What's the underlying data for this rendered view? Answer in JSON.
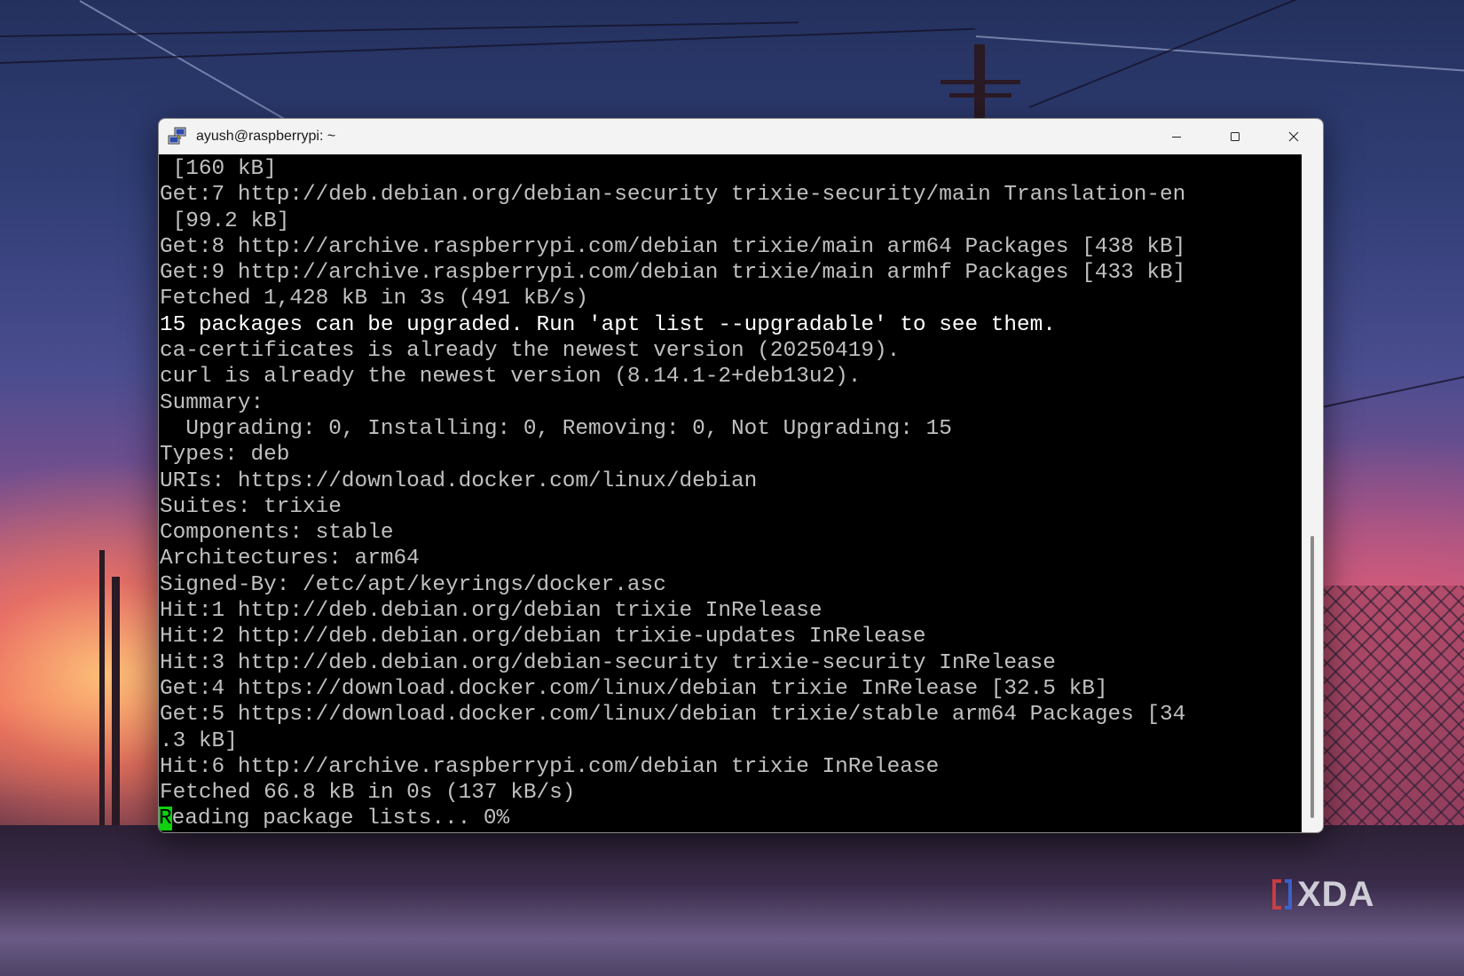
{
  "window": {
    "title": "ayush@raspberrypi: ~",
    "app_icon": "putty-icon",
    "controls": {
      "minimize_icon": "minimize-icon",
      "maximize_icon": "maximize-icon",
      "close_icon": "close-icon"
    }
  },
  "terminal": {
    "lines": [
      {
        "text": " [160 kB]",
        "bright": false
      },
      {
        "text": "Get:7 http://deb.debian.org/debian-security trixie-security/main Translation-en",
        "bright": false
      },
      {
        "text": " [99.2 kB]",
        "bright": false
      },
      {
        "text": "Get:8 http://archive.raspberrypi.com/debian trixie/main arm64 Packages [438 kB]",
        "bright": false
      },
      {
        "text": "Get:9 http://archive.raspberrypi.com/debian trixie/main armhf Packages [433 kB]",
        "bright": false
      },
      {
        "text": "Fetched 1,428 kB in 3s (491 kB/s)",
        "bright": false
      },
      {
        "text": "15 packages can be upgraded. Run 'apt list --upgradable' to see them.",
        "bright": true
      },
      {
        "text": "ca-certificates is already the newest version (20250419).",
        "bright": false
      },
      {
        "text": "curl is already the newest version (8.14.1-2+deb13u2).",
        "bright": false
      },
      {
        "text": "Summary:",
        "bright": false
      },
      {
        "text": "  Upgrading: 0, Installing: 0, Removing: 0, Not Upgrading: 15",
        "bright": false
      },
      {
        "text": "Types: deb",
        "bright": false
      },
      {
        "text": "URIs: https://download.docker.com/linux/debian",
        "bright": false
      },
      {
        "text": "Suites: trixie",
        "bright": false
      },
      {
        "text": "Components: stable",
        "bright": false
      },
      {
        "text": "Architectures: arm64",
        "bright": false
      },
      {
        "text": "Signed-By: /etc/apt/keyrings/docker.asc",
        "bright": false
      },
      {
        "text": "Hit:1 http://deb.debian.org/debian trixie InRelease",
        "bright": false
      },
      {
        "text": "Hit:2 http://deb.debian.org/debian trixie-updates InRelease",
        "bright": false
      },
      {
        "text": "Hit:3 http://deb.debian.org/debian-security trixie-security InRelease",
        "bright": false
      },
      {
        "text": "Get:4 https://download.docker.com/linux/debian trixie InRelease [32.5 kB]",
        "bright": false
      },
      {
        "text": "Get:5 https://download.docker.com/linux/debian trixie/stable arm64 Packages [34",
        "bright": false
      },
      {
        "text": ".3 kB]",
        "bright": false
      },
      {
        "text": "Hit:6 http://archive.raspberrypi.com/debian trixie InRelease",
        "bright": false
      },
      {
        "text": "Fetched 66.8 kB in 0s (137 kB/s)",
        "bright": false
      }
    ],
    "cursor_line": {
      "cursor_char": "R",
      "rest": "eading package lists... 0%"
    }
  },
  "watermark": {
    "text": "XDA"
  },
  "colors": {
    "terminal_bg": "#000000",
    "terminal_fg": "#c0c0c0",
    "terminal_bright": "#ffffff",
    "cursor": "#10d010",
    "titlebar_bg": "#f3f3f3"
  }
}
